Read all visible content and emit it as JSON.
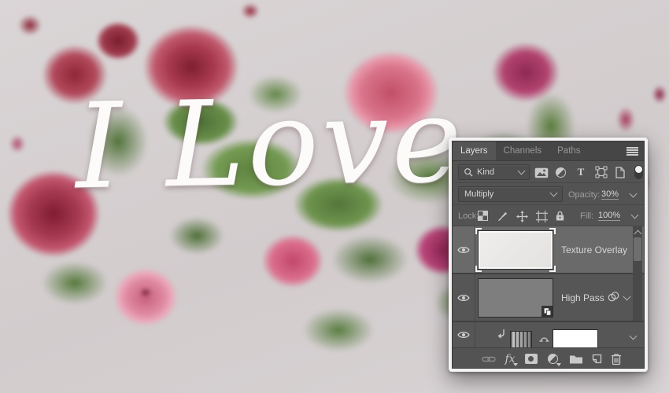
{
  "canvas": {
    "artwork_text": "I Love"
  },
  "panel": {
    "tabs": [
      {
        "label": "Layers",
        "active": true
      },
      {
        "label": "Channels",
        "active": false
      },
      {
        "label": "Paths",
        "active": false
      }
    ],
    "filter": {
      "kind_label": "Kind",
      "type_icon_label": "T"
    },
    "blend": {
      "mode": "Multiply",
      "opacity_label": "Opacity:",
      "opacity_value": "30%"
    },
    "lock": {
      "label": "Lock:",
      "fill_label": "Fill:",
      "fill_value": "100%"
    },
    "layers": [
      {
        "name": "Texture Overlay",
        "selected": true,
        "thumbnail": "white-texture"
      },
      {
        "name": "High Pass",
        "selected": false,
        "thumbnail": "gray-smart-object",
        "smart_filter": true
      },
      {
        "name": "",
        "selected": false,
        "thumbnail": "gradient",
        "clipped": true,
        "mask": "white"
      }
    ],
    "toolbar": {
      "fx_label": "fx"
    },
    "icons": [
      "panel-menu",
      "search",
      "pixel-layer-filter",
      "adjustment-layer-filter",
      "type-layer-filter",
      "shape-layer-filter",
      "smart-object-filter",
      "filter-toggle",
      "lock-transparency",
      "lock-pixels",
      "lock-position",
      "lock-artboard",
      "lock-all",
      "visibility-eye",
      "smart-object-badge",
      "smart-filter",
      "clipping-arrow",
      "mask-link",
      "link-layers",
      "layer-style-fx",
      "add-layer-mask",
      "new-adjustment-layer",
      "new-group-folder",
      "new-layer",
      "delete-layer-trash",
      "chevron-down",
      "scroll-up-arrow"
    ],
    "colors": {
      "panel_bg": "#535353",
      "tab_bar": "#464646",
      "selected_row": "#6a6a6a",
      "icon": "#c9c9c9",
      "label_text": "#9f9f9f",
      "value_text": "#d8d8d8"
    }
  }
}
